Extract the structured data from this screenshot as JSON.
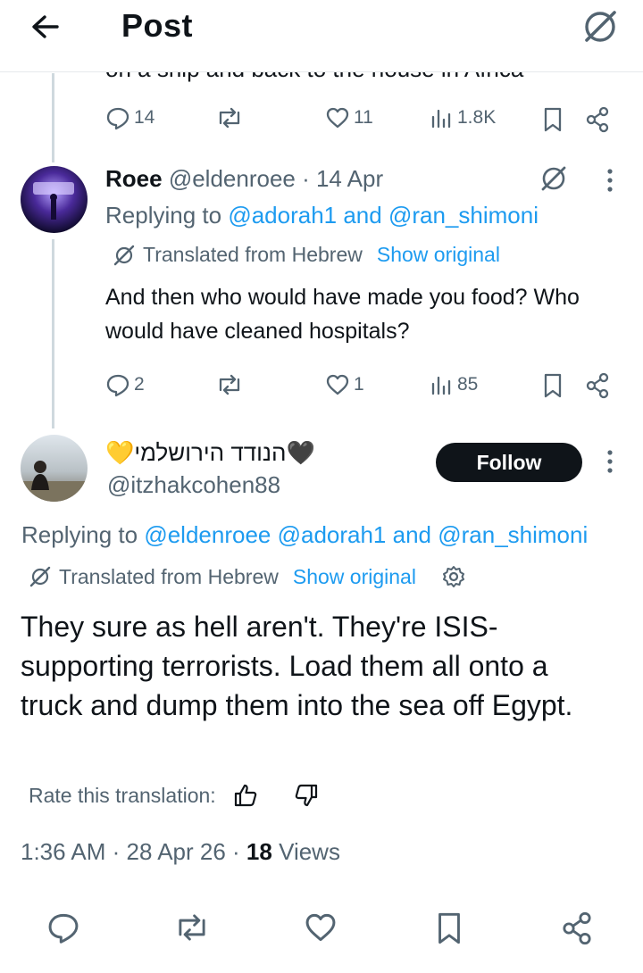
{
  "header": {
    "title": "Post"
  },
  "previous_post": {
    "clipped_text": "on a ship and back to the house in Africa",
    "stats": {
      "replies": "14",
      "reposts": "",
      "likes": "11",
      "views": "1.8K"
    }
  },
  "reply": {
    "display_name": "Roee",
    "handle_time": "@eldenroee · 14 Apr",
    "replying_prefix": "Replying to ",
    "replying_users": "@adorah1 and @ran_shimoni",
    "translated_label": "Translated from Hebrew",
    "show_original": "Show original",
    "text": "And then who would have made you food? Who would have cleaned hospitals?",
    "stats": {
      "replies": "2",
      "likes": "1",
      "views": "85"
    }
  },
  "main_post": {
    "display_name": "💛הנודד הירושלמי🖤",
    "handle": "@itzhakcohen88",
    "follow_label": "Follow",
    "replying_prefix": "Replying to ",
    "replying_users": "@eldenroee @adorah1 and @ran_shimoni",
    "translated_label": "Translated from Hebrew",
    "show_original": "Show original",
    "text": "They sure as hell aren't. They're ISIS-supporting terrorists. Load them all onto a truck and dump them into the sea off Egypt.",
    "rate_label": "Rate this translation:",
    "timestamp": "1:36 AM · 28 Apr 26 · ",
    "views_count": "18",
    "views_label": " Views"
  },
  "colors": {
    "link": "#1d9bf0",
    "muted": "#536471",
    "text": "#0f1419",
    "button": "#0f1419"
  },
  "icons": [
    "back-arrow-icon",
    "grok-icon",
    "reply-icon",
    "repost-icon",
    "like-icon",
    "views-icon",
    "bookmark-icon",
    "share-icon",
    "more-icon",
    "translate-icon",
    "settings-gear-icon",
    "thumbs-up-icon",
    "thumbs-down-icon"
  ]
}
